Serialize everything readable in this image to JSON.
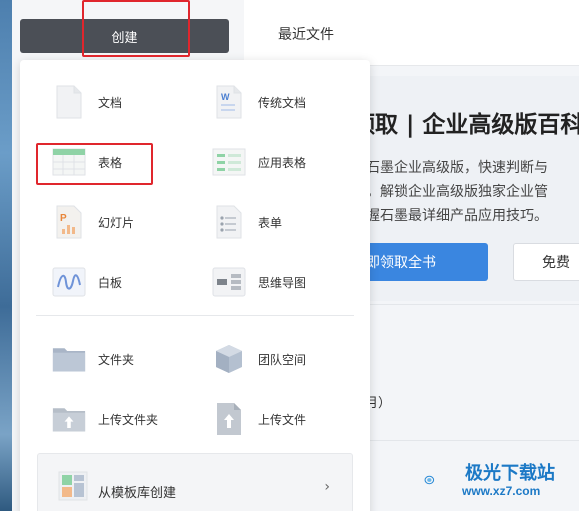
{
  "header": {
    "create_label": "创建",
    "recent_tab": "最近文件"
  },
  "banner": {
    "title": "领取 | 企业高级版百科",
    "line1": "解石墨企业高级版，快速判断与",
    "line2": "配。解锁企业高级版独家企业管",
    "line3": "掌握石墨最详细产品应用技巧。",
    "get_book": "即领取全书",
    "free": "免费",
    "month_text": "（月）"
  },
  "menu": {
    "doc": "文档",
    "trad_doc": "传统文档",
    "table": "表格",
    "app_table": "应用表格",
    "slides": "幻灯片",
    "form": "表单",
    "whiteboard": "白板",
    "mindmap": "思维导图",
    "folder": "文件夹",
    "team_space": "团队空间",
    "upload_folder": "上传文件夹",
    "upload_file": "上传文件",
    "from_template": "从模板库创建",
    "chevron": "›"
  },
  "watermark": {
    "name": "极光下载站",
    "url": "www.xz7.com"
  },
  "colors": {
    "create_button": "#4b4f56",
    "highlight": "#e0262d",
    "primary_blue": "#3a86e0"
  }
}
